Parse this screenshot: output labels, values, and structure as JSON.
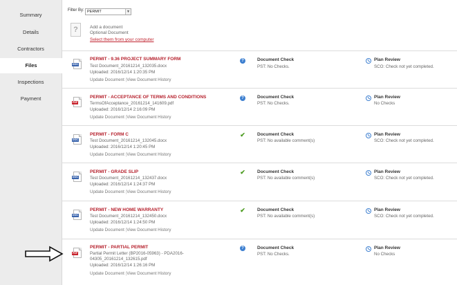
{
  "sidebar": {
    "items": [
      {
        "label": "Summary"
      },
      {
        "label": "Details"
      },
      {
        "label": "Contractors"
      },
      {
        "label": "Files",
        "active": true
      },
      {
        "label": "Inspections"
      },
      {
        "label": "Payment"
      }
    ]
  },
  "filter": {
    "label": "Filter By:",
    "selected": "PERMIT"
  },
  "add_document": {
    "title": "Add a document",
    "subtitle": "Optional Document",
    "link": "Select them from your computer"
  },
  "documents": [
    {
      "title": "PERMIT - 9.36 PROJECT SUMMARY FORM",
      "filename": "Test Document_20161214_132035.docx",
      "uploaded": "Uploaded: 2016/12/14 1:20:35 PM",
      "file_type": "docx",
      "actions": {
        "update": "Update Document",
        "history": "View Document History"
      },
      "check_status_icon": "question-icon",
      "check_title": "Document Check",
      "check_text": "PST: No Checks.",
      "plan_title": "Plan Review",
      "plan_text": "SCO: Check not yet completed."
    },
    {
      "title": "PERMIT - ACCEPTANCE OF TERMS AND CONDITIONS",
      "filename": "TermsOfAcceptance_20161214_141609.pdf",
      "uploaded": "Uploaded: 2016/12/14 2:16:09 PM",
      "file_type": "pdf",
      "actions": {
        "update": "Update Document",
        "history": "View Document History"
      },
      "check_status_icon": "question-icon",
      "check_title": "Document Check",
      "check_text": "PST: No Checks.",
      "plan_title": "Plan Review",
      "plan_text": "No Checks"
    },
    {
      "title": "PERMIT - FORM C",
      "filename": "Test Document_20161214_132045.docx",
      "uploaded": "Uploaded: 2016/12/14 1:20:45 PM",
      "file_type": "docx",
      "actions": {
        "update": "Update Document",
        "history": "View Document History"
      },
      "check_status_icon": "checkmark-icon",
      "check_title": "Document Check",
      "check_text": "PST: No available comment(s)",
      "plan_title": "Plan Review",
      "plan_text": "SCO: Check not yet completed."
    },
    {
      "title": "PERMIT - GRADE SLIP",
      "filename": "Test Document_20161214_132437.docx",
      "uploaded": "Uploaded: 2016/12/14 1:24:37 PM",
      "file_type": "docx",
      "actions": {
        "update": "Update Document",
        "history": "View Document History"
      },
      "check_status_icon": "checkmark-icon",
      "check_title": "Document Check",
      "check_text": "PST: No available comment(s)",
      "plan_title": "Plan Review",
      "plan_text": "SCO: Check not yet completed."
    },
    {
      "title": "PERMIT - NEW HOME WARRANTY",
      "filename": "Test Document_20161214_132450.docx",
      "uploaded": "Uploaded: 2016/12/14 1:24:50 PM",
      "file_type": "docx",
      "actions": {
        "update": "Update Document",
        "history": "View Document History"
      },
      "check_status_icon": "checkmark-icon",
      "check_title": "Document Check",
      "check_text": "PST: No available comment(s)",
      "plan_title": "Plan Review",
      "plan_text": "SCO: Check not yet completed."
    },
    {
      "title": "PERMIT - PARTIAL PERMIT",
      "filename": "Partial Permit Letter (BP2016-05963) - PDA2016-",
      "filename2": "04305_20161214_132615.pdf",
      "uploaded": "Uploaded: 2016/12/14 1:26:16 PM",
      "file_type": "pdf",
      "actions": {
        "update": "Update Document",
        "history": "View Document History"
      },
      "check_status_icon": "question-icon",
      "check_title": "Document Check",
      "check_text": "PST: No Checks.",
      "plan_title": "Plan Review",
      "plan_text": "No Checks"
    }
  ],
  "file_badges": {
    "docx": "DOC",
    "pdf": "PDF"
  },
  "colors": {
    "title_red": "#b51f2b",
    "link_red": "#c0232f",
    "status_blue": "#3d7fd0",
    "status_green": "#4a9a1e"
  }
}
